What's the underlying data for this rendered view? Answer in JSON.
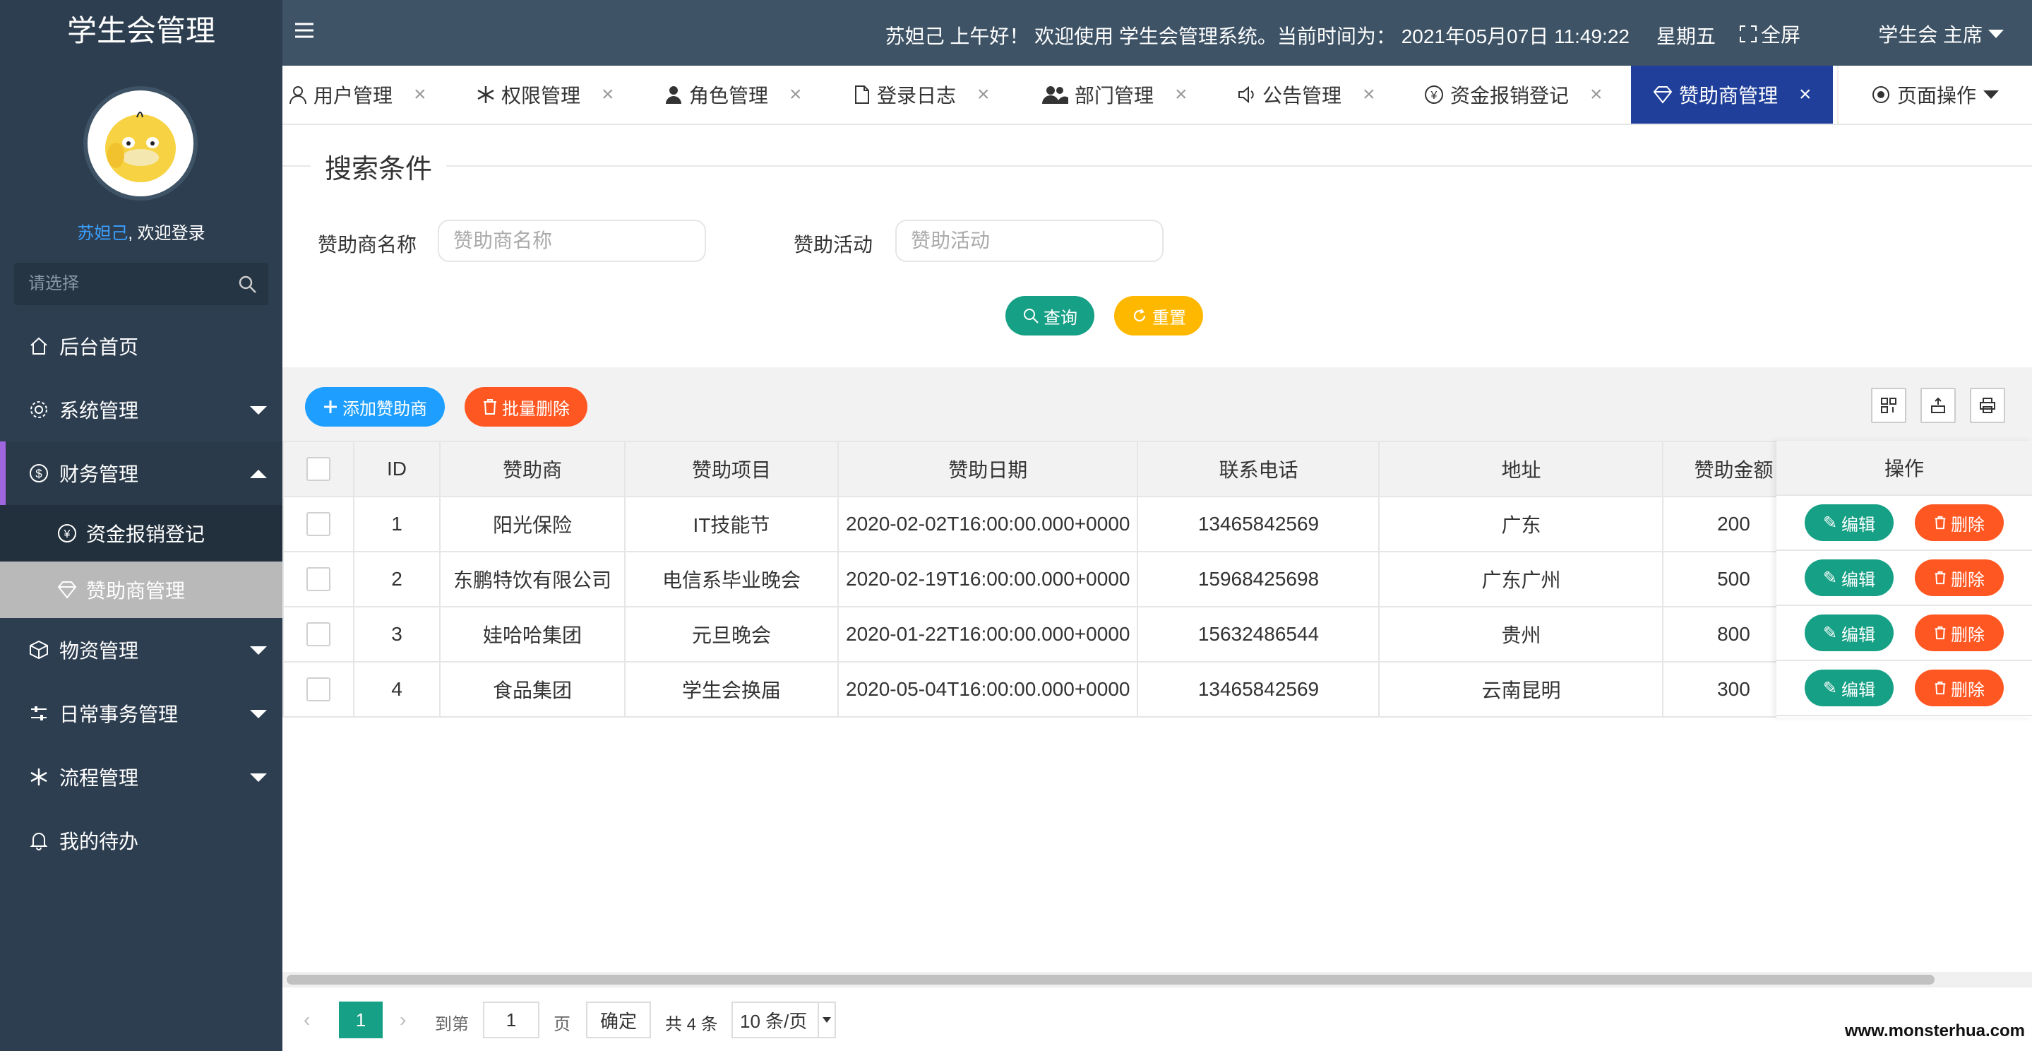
{
  "app": {
    "title": "学生会管理",
    "user_display": "苏妲己",
    "welcome_suffix": ", 欢迎登录",
    "greeting": "苏妲己 上午好！ 欢迎使用 学生会管理系统。当前时间为： 2021年05月07日 11:49:22",
    "weekday": "星期五",
    "fullscreen_label": "全屏",
    "user_role": "学生会 主席"
  },
  "sidebar": {
    "search_placeholder": "请选择",
    "menu": [
      {
        "label": "后台首页",
        "icon": "home-icon"
      },
      {
        "label": "系统管理",
        "icon": "gear-icon"
      },
      {
        "label": "财务管理",
        "icon": "dollar-icon",
        "expanded": true
      },
      {
        "label": "物资管理",
        "icon": "box-icon"
      },
      {
        "label": "日常事务管理",
        "icon": "sliders-icon"
      },
      {
        "label": "流程管理",
        "icon": "snowflake-icon"
      },
      {
        "label": "我的待办",
        "icon": "bell-icon"
      }
    ],
    "submenu": [
      {
        "label": "资金报销登记",
        "icon": "yen-icon"
      },
      {
        "label": "赞助商管理",
        "icon": "diamond-icon",
        "selected": true
      }
    ]
  },
  "tabs": [
    {
      "label": "用户管理",
      "icon": "user-icon"
    },
    {
      "label": "权限管理",
      "icon": "snowflake-icon"
    },
    {
      "label": "角色管理",
      "icon": "person-icon"
    },
    {
      "label": "登录日志",
      "icon": "file-icon"
    },
    {
      "label": "部门管理",
      "icon": "users-icon"
    },
    {
      "label": "公告管理",
      "icon": "speaker-icon"
    },
    {
      "label": "资金报销登记",
      "icon": "yen-icon"
    },
    {
      "label": "赞助商管理",
      "icon": "diamond-icon",
      "active": true
    }
  ],
  "page_ops_label": "页面操作",
  "search": {
    "legend": "搜索条件",
    "sponsor_name_label": "赞助商名称",
    "sponsor_name_placeholder": "赞助商名称",
    "sponsor_activity_label": "赞助活动",
    "sponsor_activity_placeholder": "赞助活动",
    "query_label": "查询",
    "reset_label": "重置"
  },
  "toolbar": {
    "add_label": "添加赞助商",
    "batch_delete_label": "批量删除"
  },
  "table": {
    "columns": [
      "ID",
      "赞助商",
      "赞助项目",
      "赞助日期",
      "联系电话",
      "地址",
      "赞助金额",
      "操作"
    ],
    "rows": [
      {
        "id": "1",
        "sponsor": "阳光保险",
        "project": "IT技能节",
        "date": "2020-02-02T16:00:00.000+0000",
        "phone": "13465842569",
        "address": "广东",
        "amount": "200"
      },
      {
        "id": "2",
        "sponsor": "东鹏特饮有限公司",
        "project": "电信系毕业晚会",
        "date": "2020-02-19T16:00:00.000+0000",
        "phone": "15968425698",
        "address": "广东广州",
        "amount": "500"
      },
      {
        "id": "3",
        "sponsor": "娃哈哈集团",
        "project": "元旦晚会",
        "date": "2020-01-22T16:00:00.000+0000",
        "phone": "15632486544",
        "address": "贵州",
        "amount": "800"
      },
      {
        "id": "4",
        "sponsor": "食品集团",
        "project": "学生会换届",
        "date": "2020-05-04T16:00:00.000+0000",
        "phone": "13465842569",
        "address": "云南昆明",
        "amount": "300"
      }
    ],
    "edit_label": "编辑",
    "delete_label": "删除"
  },
  "pager": {
    "current_page": "1",
    "goto_prefix": "到第",
    "goto_value": "1",
    "goto_suffix": "页",
    "confirm_label": "确定",
    "total_text": "共 4 条",
    "page_size": "10 条/页"
  },
  "watermark": "www.monsterhua.com",
  "colors": {
    "sidebar_bg": "#2d3e50",
    "header_bg": "#3e5366",
    "active_tab": "#203f9a",
    "teal": "#16a085",
    "orange": "#ff5722",
    "yellow": "#ffb800",
    "blue": "#1e9fff"
  }
}
